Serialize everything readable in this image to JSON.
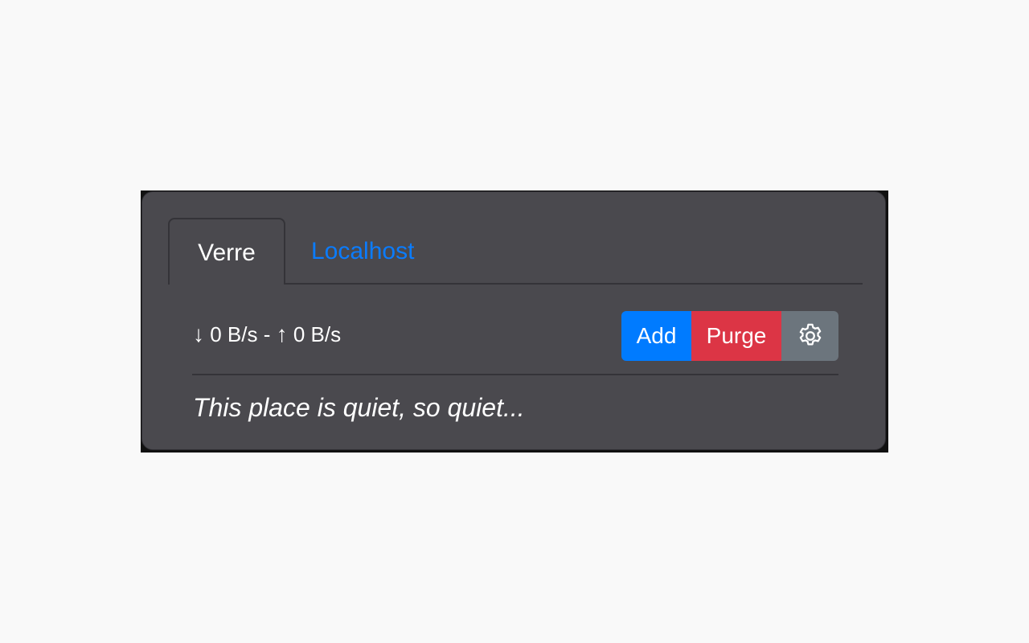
{
  "tabs": [
    {
      "label": "Verre",
      "active": true
    },
    {
      "label": "Localhost",
      "active": false
    }
  ],
  "stats": {
    "down_arrow": "↓",
    "down_rate": "0 B/s",
    "separator": "-",
    "up_arrow": "↑",
    "up_rate": "0 B/s"
  },
  "actions": {
    "add_label": "Add",
    "purge_label": "Purge",
    "settings_icon": "gear-icon"
  },
  "empty_message": "This place is quiet, so quiet...",
  "colors": {
    "panel_bg": "#4a494e",
    "add": "#007bff",
    "purge": "#dc3545",
    "settings": "#6c757d",
    "link": "#0a7cff"
  }
}
